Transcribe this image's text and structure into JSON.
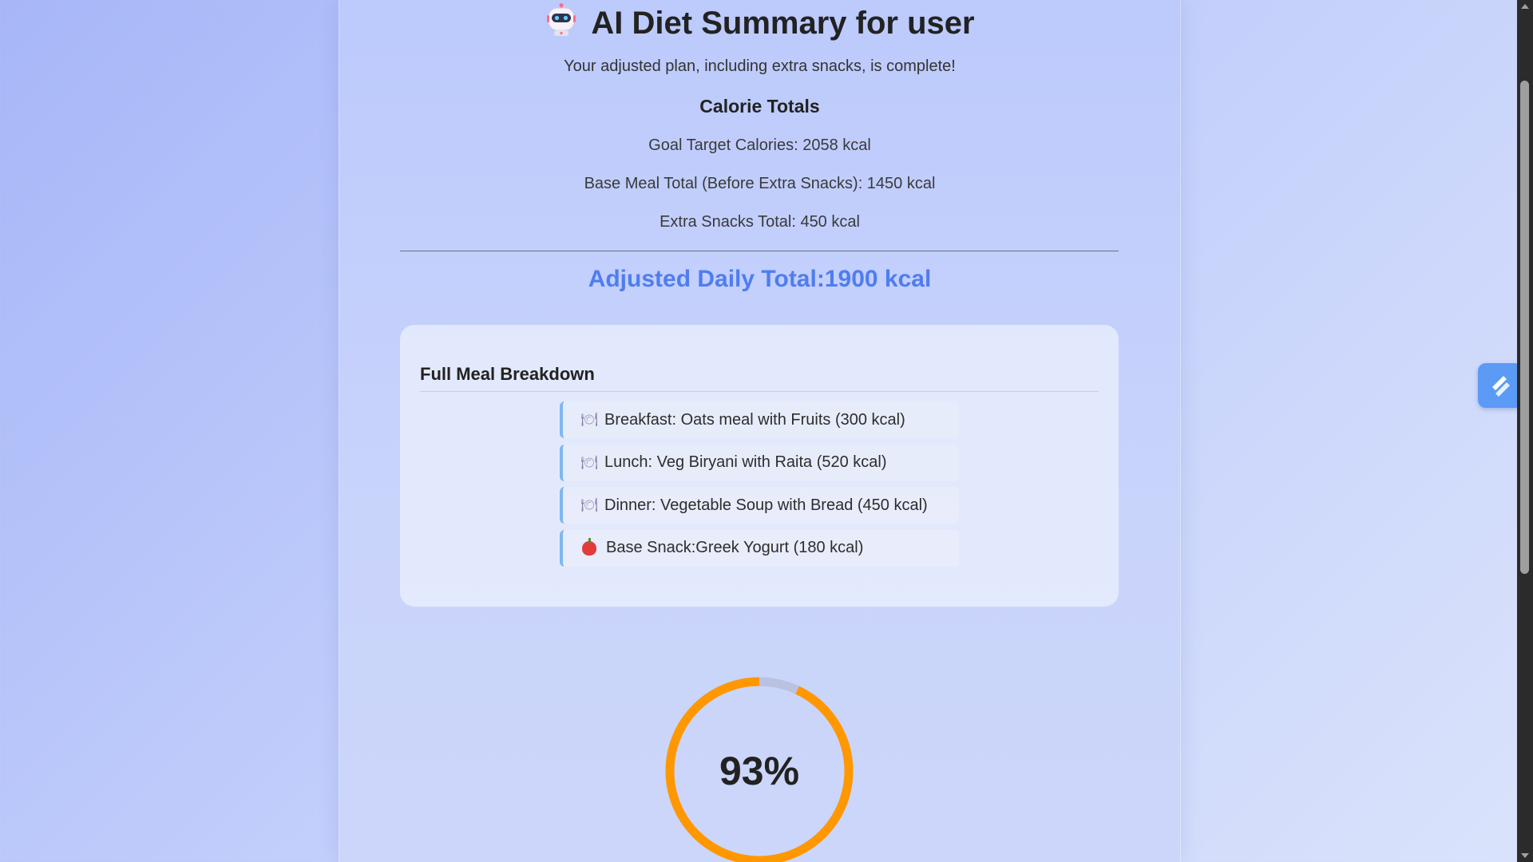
{
  "header": {
    "title": "AI Diet Summary for user",
    "icon": "robot-icon",
    "subtitle": "Your adjusted plan, including extra snacks, is complete!"
  },
  "calorie_totals": {
    "heading": "Calorie Totals",
    "goal_line": "Goal Target Calories: 2058 kcal",
    "base_line": "Base Meal Total (Before Extra Snacks): 1450 kcal",
    "extra_line": "Extra Snacks Total: 450 kcal",
    "adjusted_line": "Adjusted Daily Total:1900 kcal"
  },
  "meals": {
    "heading": "Full Meal Breakdown",
    "items": [
      {
        "icon": "plate-icon",
        "glyph": "🍽",
        "text": "Breakfast: Oats meal with Fruits (300 kcal)"
      },
      {
        "icon": "plate-icon",
        "glyph": "🍽",
        "text": "Lunch: Veg Biryani with Raita (520 kcal)"
      },
      {
        "icon": "plate-icon",
        "glyph": "🍽",
        "text": "Dinner: Vegetable Soup with Bread (450 kcal)"
      },
      {
        "icon": "apple-icon",
        "glyph": "",
        "text": "Base Snack:Greek Yogurt (180 kcal)"
      }
    ]
  },
  "progress": {
    "label": "93%",
    "fraction": 0.93,
    "color": "#ff9800",
    "track_color": "#b9c2e0"
  },
  "colors": {
    "accent": "#4f7df0",
    "widget": "#5b9af5"
  }
}
